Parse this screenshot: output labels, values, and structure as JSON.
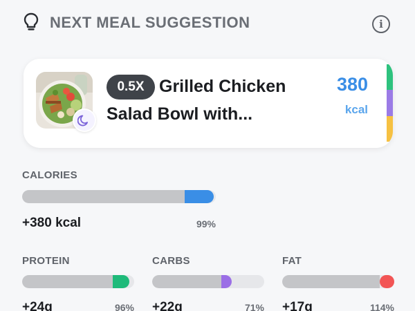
{
  "header": {
    "title": "NEXT MEAL SUGGESTION",
    "icon": "lightbulb-icon",
    "info_icon": "info-icon",
    "info_glyph": "i"
  },
  "meal": {
    "portion": "0.5X",
    "name_line1": "Grilled Chicken",
    "name_line2": "Salad Bowl with...",
    "kcal_value": "380",
    "kcal_unit": "kcal",
    "meal_time_icon": "moon-icon",
    "macro_colors": [
      "#2ec27e",
      "#9b7be6",
      "#f6c142"
    ]
  },
  "calories": {
    "label": "CALORIES",
    "amount": "+380 kcal",
    "percent": "99%",
    "base_fraction": 0.84,
    "added_fraction": 0.15,
    "color": "#3a8ee6"
  },
  "macros": [
    {
      "label": "PROTEIN",
      "amount": "+24g",
      "percent": "96%",
      "base_fraction": 0.81,
      "added_fraction": 0.15,
      "color": "#1fba7a"
    },
    {
      "label": "CARBS",
      "amount": "+22g",
      "percent": "71%",
      "base_fraction": 0.62,
      "added_fraction": 0.09,
      "color": "#9b6fe6"
    },
    {
      "label": "FAT",
      "amount": "+17g",
      "percent": "114%",
      "base_fraction": 0.87,
      "added_fraction": 0.14,
      "color": "#f25555"
    }
  ]
}
